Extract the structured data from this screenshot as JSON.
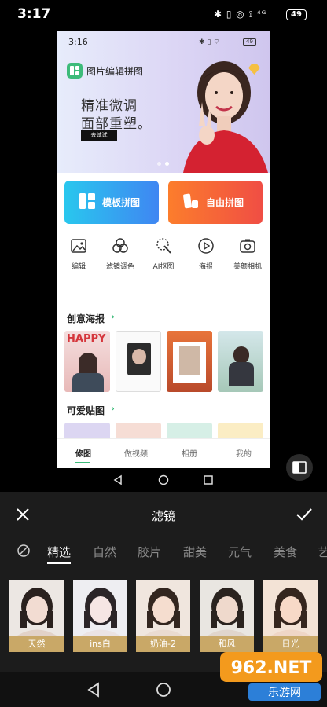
{
  "status_bar": {
    "time": "3:17",
    "icons": "✱ ▯ ◎ ⟟ ⁴ᴳ",
    "battery": "49"
  },
  "inner_screen": {
    "status_time": "3:16",
    "status_battery": "49",
    "app_title": "图片编辑拼图",
    "banner": {
      "line1": "精准微调",
      "line2": "面部重塑。",
      "button": "去试试"
    },
    "big_buttons": [
      {
        "label": "模板拼图",
        "color": "#3f86f2"
      },
      {
        "label": "自由拼图",
        "color": "#f04e44"
      }
    ],
    "tools": [
      {
        "label": "编辑",
        "icon": "image-icon"
      },
      {
        "label": "滤镜调色",
        "icon": "filter-circles-icon"
      },
      {
        "label": "AI抠图",
        "icon": "magic-wand-icon"
      },
      {
        "label": "海报",
        "icon": "play-icon"
      },
      {
        "label": "美颜相机",
        "icon": "camera-icon"
      }
    ],
    "section_poster": {
      "title": "创意海报",
      "arrow": "›",
      "thumb_text": "HAPPY"
    },
    "section_sticker": {
      "title": "可爱贴图",
      "arrow": "›"
    },
    "tabs": [
      "修图",
      "做视频",
      "相册",
      "我的"
    ],
    "active_tab": "修图"
  },
  "filter_sheet": {
    "title": "滤镜",
    "categories": [
      "精选",
      "自然",
      "胶片",
      "甜美",
      "元气",
      "美食",
      "艺"
    ],
    "active_category": "精选",
    "filters": [
      "天然",
      "ins白",
      "奶油-2",
      "和风",
      "日光"
    ]
  },
  "watermark": {
    "text": "962.NET",
    "sub": "乐游网"
  }
}
